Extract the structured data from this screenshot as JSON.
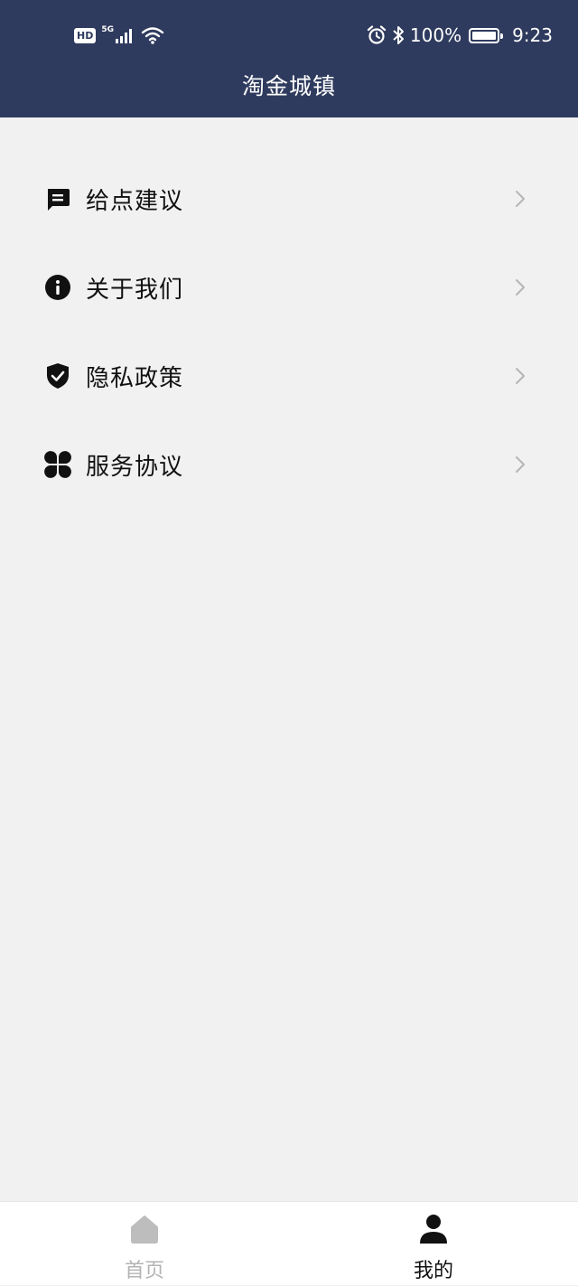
{
  "status_bar": {
    "hd_badge": "HD",
    "network_type": "5G",
    "battery_text": "100%",
    "battery_level": 1.0,
    "time": "9:23",
    "icons": [
      "signal-icon",
      "wifi-icon",
      "alarm-icon",
      "bluetooth-icon",
      "battery-icon"
    ]
  },
  "header": {
    "title": "淘金城镇",
    "background_color": "#2f3b5e"
  },
  "menu": {
    "items": [
      {
        "label": "给点建议",
        "icon": "message-icon"
      },
      {
        "label": "关于我们",
        "icon": "info-icon"
      },
      {
        "label": "隐私政策",
        "icon": "shield-check-icon"
      },
      {
        "label": "服务协议",
        "icon": "clover-icon"
      }
    ]
  },
  "tabbar": {
    "tabs": [
      {
        "label": "首页",
        "icon": "home-icon",
        "active": false
      },
      {
        "label": "我的",
        "icon": "person-icon",
        "active": true
      }
    ]
  }
}
